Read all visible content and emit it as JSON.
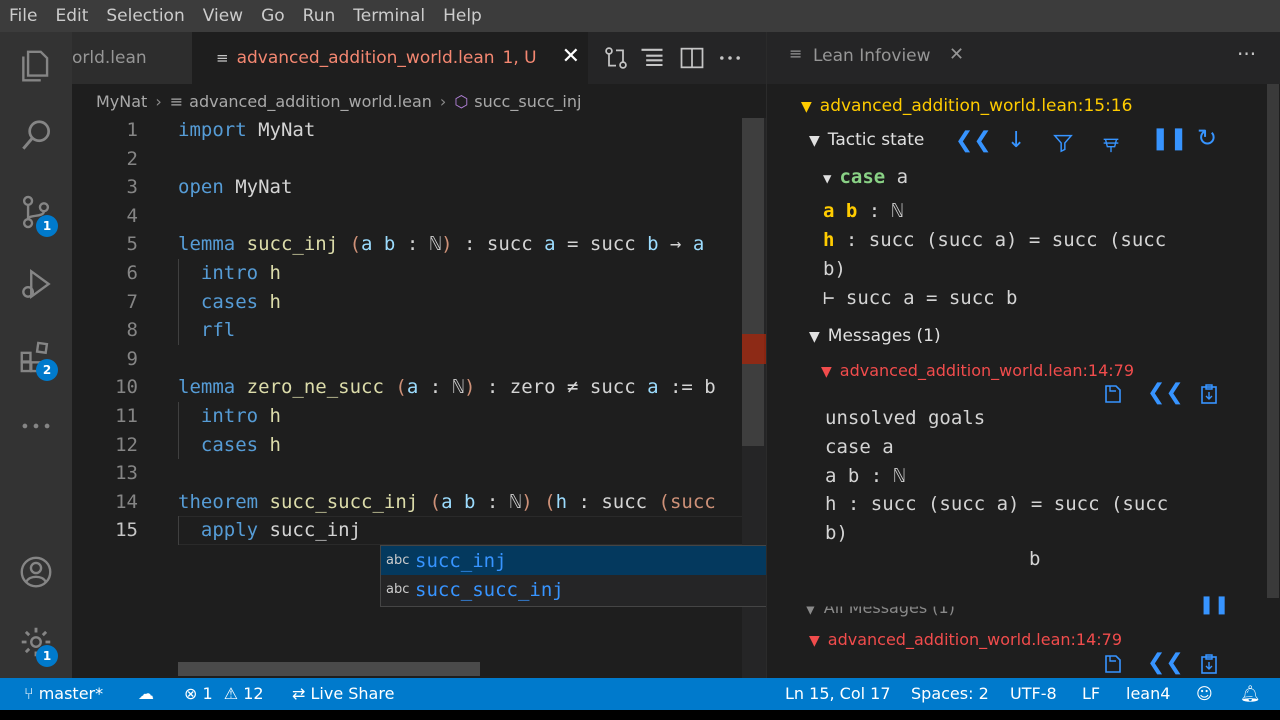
{
  "menu": [
    "File",
    "Edit",
    "Selection",
    "View",
    "Go",
    "Run",
    "Terminal",
    "Help"
  ],
  "activity": {
    "source_control_badge": "1",
    "extensions_badge": "2",
    "settings_badge": "1"
  },
  "tabs": {
    "tab1": "orld.lean",
    "tab2": "advanced_addition_world.lean",
    "tab2_status": "1, U"
  },
  "breadcrumb": {
    "folder": "MyNat",
    "file": "advanced_addition_world.lean",
    "symbol": "succ_succ_inj"
  },
  "editor": {
    "line_numbers": [
      "1",
      "2",
      "3",
      "4",
      "5",
      "6",
      "7",
      "8",
      "9",
      "10",
      "11",
      "12",
      "13",
      "14",
      "15"
    ],
    "lines": [
      [
        {
          "t": "import",
          "c": "kw"
        },
        {
          "t": " MyNat",
          "c": "cm"
        }
      ],
      [],
      [
        {
          "t": "open",
          "c": "kw"
        },
        {
          "t": " MyNat",
          "c": "cm"
        }
      ],
      [],
      [
        {
          "t": "lemma",
          "c": "kw"
        },
        {
          "t": " succ_inj",
          "c": "id"
        },
        {
          "t": " (",
          "c": "rp"
        },
        {
          "t": "a b",
          "c": "ty"
        },
        {
          "t": " : ℕ",
          "c": "cm"
        },
        {
          "t": ")",
          "c": "rp"
        },
        {
          "t": " : succ ",
          "c": "cm"
        },
        {
          "t": "a",
          "c": "ty"
        },
        {
          "t": " = succ ",
          "c": "cm"
        },
        {
          "t": "b",
          "c": "ty"
        },
        {
          "t": " → ",
          "c": "cm"
        },
        {
          "t": "a",
          "c": "ty"
        }
      ],
      [
        {
          "t": "  intro",
          "c": "kw"
        },
        {
          "t": " h",
          "c": "id"
        }
      ],
      [
        {
          "t": "  cases",
          "c": "kw"
        },
        {
          "t": " h",
          "c": "id"
        }
      ],
      [
        {
          "t": "  rfl",
          "c": "kw"
        }
      ],
      [],
      [
        {
          "t": "lemma",
          "c": "kw"
        },
        {
          "t": " zero_ne_succ",
          "c": "id"
        },
        {
          "t": " (",
          "c": "rp"
        },
        {
          "t": "a",
          "c": "ty"
        },
        {
          "t": " : ℕ",
          "c": "cm"
        },
        {
          "t": ")",
          "c": "rp"
        },
        {
          "t": " : zero ≠ succ ",
          "c": "cm"
        },
        {
          "t": "a",
          "c": "ty"
        },
        {
          "t": " := b",
          "c": "cm"
        }
      ],
      [
        {
          "t": "  intro",
          "c": "kw"
        },
        {
          "t": " h",
          "c": "id"
        }
      ],
      [
        {
          "t": "  cases",
          "c": "kw"
        },
        {
          "t": " h",
          "c": "id"
        }
      ],
      [],
      [
        {
          "t": "theorem",
          "c": "kw"
        },
        {
          "t": " succ_succ_inj",
          "c": "id"
        },
        {
          "t": " (",
          "c": "rp"
        },
        {
          "t": "a b",
          "c": "ty"
        },
        {
          "t": " : ℕ",
          "c": "cm"
        },
        {
          "t": ")",
          "c": "rp"
        },
        {
          "t": " (",
          "c": "rp"
        },
        {
          "t": "h",
          "c": "ty"
        },
        {
          "t": " : succ ",
          "c": "cm"
        },
        {
          "t": "(succ",
          "c": "rp"
        }
      ],
      [
        {
          "t": "  apply",
          "c": "kw"
        },
        {
          "t": " succ_inj",
          "c": "cm"
        }
      ]
    ]
  },
  "suggestions": [
    {
      "kind": "abc",
      "match": "succ_inj",
      "rest": ""
    },
    {
      "kind": "abc",
      "prefix": "succ_",
      "match": "succ_inj"
    }
  ],
  "infoview": {
    "tab_label": "Lean Infoview",
    "location": "advanced_addition_world.lean:15:16",
    "tactic_state_label": "Tactic state",
    "case_kw": "case",
    "case_name": "a",
    "hyp1_names": "a b",
    "hyp1_type": " : ℕ",
    "hyp2_name": "h",
    "hyp2_type_line1": " : succ (succ a) = succ (succ",
    "hyp2_type_line2": "b)",
    "goal": "⊢ succ a = succ b",
    "messages_label": "Messages (1)",
    "message_location": "advanced_addition_world.lean:14:79",
    "message_lines": [
      "unsolved goals",
      "case a",
      "a b : ℕ",
      "h : succ (succ a) = succ (succ",
      "b)"
    ],
    "message_tail": "b",
    "all_messages_label": "All Messages (1)",
    "all_message_location": "advanced_addition_world.lean:14:79"
  },
  "status": {
    "branch": "master*",
    "errors": "1",
    "warnings": "12",
    "live_share": "Live Share",
    "position": "Ln 15, Col 17",
    "spaces": "Spaces: 2",
    "encoding": "UTF-8",
    "eol": "LF",
    "language": "lean4"
  },
  "colors": {
    "accent": "#007acc",
    "error": "#f14c4c",
    "keyword": "#569cd6",
    "function": "#dcdcaa"
  }
}
